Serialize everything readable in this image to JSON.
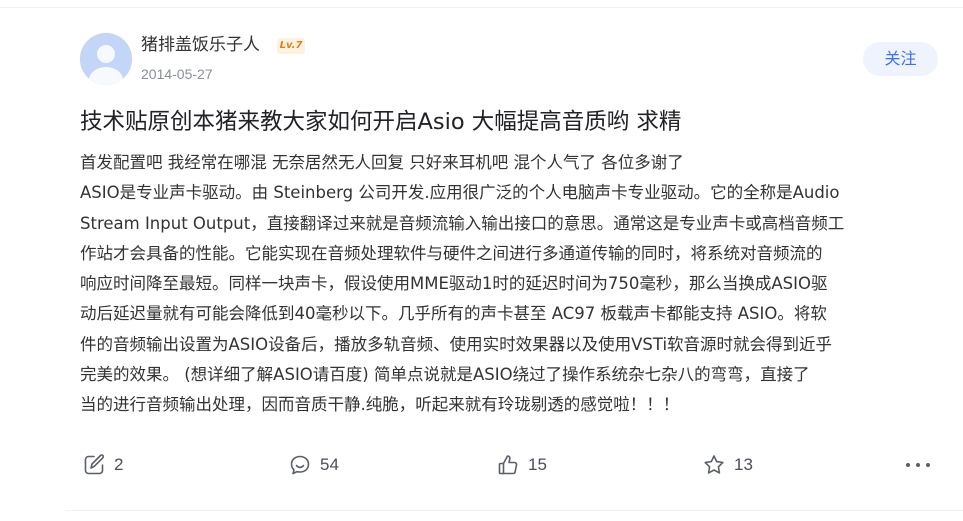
{
  "post": {
    "author": {
      "name": "猪排盖饭乐子人",
      "level": "Lv.7",
      "date": "2014-05-27"
    },
    "follow_label": "关注",
    "title": "技术贴原创本猪来教大家如何开启Asio 大幅提高音质哟 求精",
    "body_lines": [
      "首发配置吧 我经常在哪混 无奈居然无人回复 只好来耳机吧 混个人气了 各位多谢了",
      "ASIO是专业声卡驱动。由 Steinberg 公司开发.应用很广泛的个人电脑声卡专业驱动。它的全称是Audio",
      "Stream Input Output，直接翻译过来就是音频流输入输出接口的意思。通常这是专业声卡或高档音频工",
      "作站才会具备的性能。它能实现在音频处理软件与硬件之间进行多通道传输的同时，将系统对音频流的",
      "响应时间降至最短。同样一块声卡，假设使用MME驱动1时的延迟时间为750毫秒，那么当换成ASIO驱",
      "动后延迟量就有可能会降低到40毫秒以下。几乎所有的声卡甚至 AC97 板载声卡都能支持 ASIO。将软",
      "件的音频输出设置为ASIO设备后，播放多轨音频、使用实时效果器以及使用VSTi软音源时就会得到近乎",
      "完美的效果。 (想详细了解ASIO请百度) 简单点说就是ASIO绕过了操作系统杂七杂八的弯弯，直接了",
      "当的进行音频输出处理，因而音质干静.纯脆，听起来就有玲珑剔透的感觉啦！！！"
    ],
    "actions": {
      "share_count": "2",
      "comment_count": "54",
      "like_count": "15",
      "favorite_count": "13"
    }
  },
  "colors": {
    "accent": "#3b6ff5",
    "follow_bg": "#eef3fe",
    "level_badge": "#d9821e",
    "muted": "#8a8f99"
  },
  "icons": {
    "share": "share-edit-icon",
    "comment": "comment-bubble-icon",
    "like": "thumbs-up-icon",
    "favorite": "star-icon",
    "more": "more-dots-icon"
  }
}
